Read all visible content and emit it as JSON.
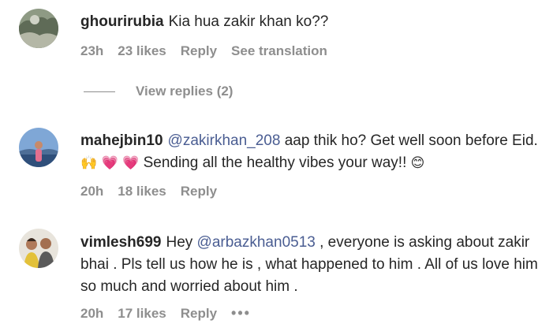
{
  "comments": [
    {
      "username": "ghourirubia",
      "text": "Kia hua zakir khan ko??",
      "time": "23h",
      "likes": "23 likes",
      "reply": "Reply",
      "extra": "See translation"
    },
    {
      "username": "mahejbin10",
      "mention": "@zakirkhan_208",
      "text1": " aap thik ho? Get well soon before Eid.",
      "emoji1": "🙌 💗 💗",
      "text2": "  Sending all the healthy vibes your way!!",
      "emoji2": "😊",
      "time": "20h",
      "likes": "18 likes",
      "reply": "Reply"
    },
    {
      "username": "vimlesh699",
      "text1": "Hey ",
      "mention": "@arbazkhan0513",
      "text2": " , everyone is asking about zakir bhai . Pls tell us how he is , what happened to him . All of us love him so much and worried about him .",
      "time": "20h",
      "likes": "17 likes",
      "reply": "Reply",
      "more": "•••"
    }
  ],
  "view_replies": "View replies (2)"
}
